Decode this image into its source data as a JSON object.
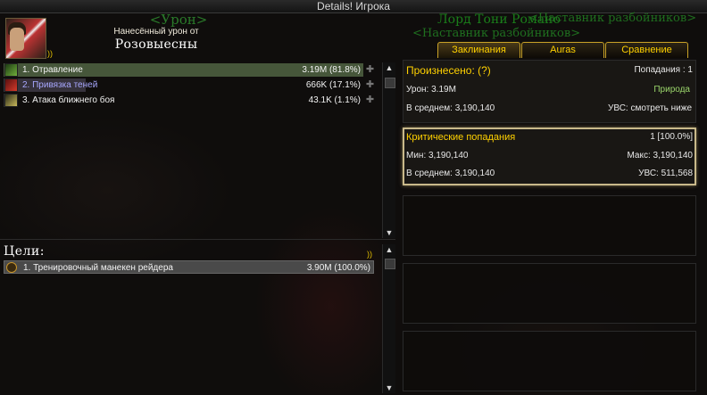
{
  "window": {
    "title": "Details! Игрока"
  },
  "header": {
    "damage_title": "<Урон>",
    "damage_from": "Нанесённый урон от",
    "player_name": "Розовыесны",
    "target_name": "Лорд Тони Романо",
    "target_subtitle_overlap": "<Наставник разбойников>",
    "target_subtitle": "<Наставник разбойников>"
  },
  "tabs": [
    {
      "label": "Заклинания"
    },
    {
      "label": "Auras"
    },
    {
      "label": "Сравнение"
    }
  ],
  "spells": [
    {
      "label": "1. Отравление",
      "value": "3.19M (81.8%)",
      "icon": "poison-icon",
      "share": 0.818
    },
    {
      "label": "2. Привязка теней",
      "value": "666K (17.1%)",
      "icon": "shadow-bind-icon",
      "share": 0.171
    },
    {
      "label": "3. Атака ближнего боя",
      "value": "43.1K (1.1%)",
      "icon": "melee-sword-icon",
      "share": 0.011
    }
  ],
  "targets": {
    "title": "Цели:",
    "rows": [
      {
        "label": "1. Тренировочный манекен рейдера",
        "value": "3.90M (100.0%)",
        "icon": "skull-icon"
      }
    ]
  },
  "details": {
    "cast": {
      "title": "Произнесено: (?)",
      "hits": "Попадания : 1",
      "damage": "Урон: 3.19M",
      "school": "Природа",
      "average": "В среднем: 3,190,140",
      "dps": "УВС: смотреть ниже"
    },
    "crit": {
      "title": "Критические попадания",
      "count": "1 [100.0%]",
      "min": "Мин: 3,190,140",
      "max": "Макс: 3,190,140",
      "average": "В среднем: 3,190,140",
      "dps": "УВС: 511,568"
    }
  },
  "colors": {
    "spell_bar_1": "#46563a",
    "spell_bar_2": "#3a3a3a",
    "spell_bar_3": "#2a2a2a",
    "gold": "#ffd100",
    "nature": "#9bd66b"
  }
}
